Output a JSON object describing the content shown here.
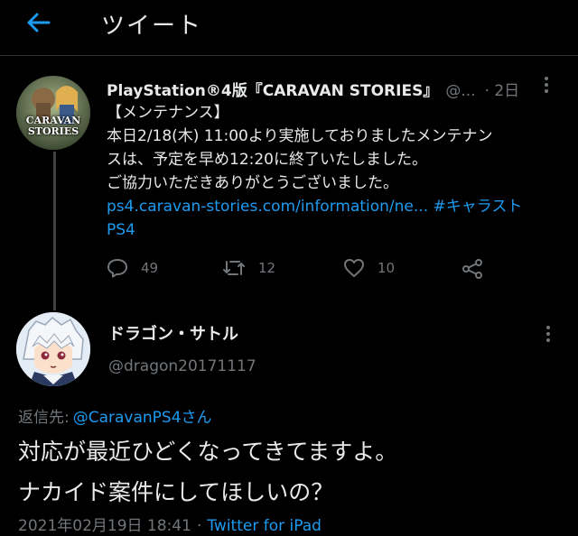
{
  "header": {
    "title": "ツイート",
    "back_icon": "arrow-left-icon"
  },
  "colors": {
    "background": "#000000",
    "accent": "#1d9bf0",
    "muted": "#71767b",
    "text": "#e7e9ea"
  },
  "tweet1": {
    "display_name": "PlayStation®4版『CARAVAN STORIES』",
    "handle": "@...",
    "time": "· 2日",
    "avatar_label_1": "CARAVAN",
    "avatar_label_2": "STORIES",
    "lines": [
      "【メンテナンス】",
      "本日2/18(木) 11:00より実施しておりましたメンテナン",
      "スは、予定を早め12:20に終了いたしました。",
      "ご協力いただきありがとうございました。"
    ],
    "link_url": "ps4.caravan-stories.com/information/ne...",
    "hashtag_part1": "#キャラスト",
    "hashtag_part2": "PS4",
    "replies": "49",
    "retweets": "12",
    "likes": "10"
  },
  "tweet2": {
    "display_name": "ドラゴン・サトル",
    "handle": "@dragon20171117",
    "reply_prefix": "返信先:",
    "reply_target": "@CaravanPS4さん",
    "text_line1": "対応が最近ひどくなってきてますよ。",
    "text_line2": "ナカイド案件にしてほしいの？",
    "timestamp": "2021年02月19日 18:41",
    "separator": "·",
    "source": "Twitter for iPad"
  }
}
